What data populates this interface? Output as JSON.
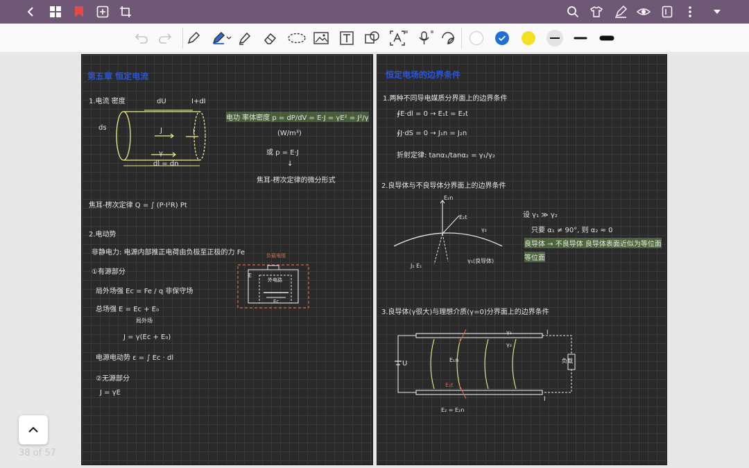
{
  "app": {
    "topbar_color": "#6f5876",
    "icons_left": [
      "back-icon",
      "grid-icon",
      "bookmark-icon",
      "add-page-icon",
      "crop-icon"
    ],
    "icons_right": [
      "search-icon",
      "shirt-icon",
      "pen-icon",
      "eye-icon",
      "book-icon",
      "more-icon",
      "chevron-down-icon"
    ]
  },
  "toolbar": {
    "tools": [
      "undo-icon",
      "redo-icon",
      "pen-tool-icon",
      "highlighter-icon",
      "marker-icon",
      "eraser-icon",
      "lasso-icon",
      "image-icon",
      "text-icon",
      "shapes-icon",
      "text-recognition-icon",
      "mic-icon",
      "sticker-icon"
    ],
    "colors": [
      "#ffffff",
      "#1e6fd9",
      "#f2e120"
    ],
    "stroke_widths": [
      "thin",
      "medium",
      "thick"
    ]
  },
  "left_page": {
    "title": "第五章 恒定电流",
    "lines": [
      "1.电流 密度",
      "dU",
      "I+dI",
      "ds",
      "J",
      "l",
      "γ",
      "dl = dn",
      "电功 率体密度  p = dP/dV = E·J = γE² = J²/γ",
      "(W/m³)",
      "或  p = E·J",
      "焦耳-楞次定律的微分形式",
      "焦耳-楞次定律  Q = ∫ (P·I²R) Pt",
      "2.电动势",
      "非静电力: 电源内部推正电荷由负极至正极的力  Fe",
      "①有源部分",
      "局外场强  Ec = Fe / q   非保守场",
      "总场强  E = Ec + E₀",
      "局外场",
      "J = γ(Ec + E₀)",
      "电源电动势  ε = ∫ Ec · dl",
      "②无源部分",
      "J = γE",
      "负载电阻",
      "外电路",
      "E",
      "Ec"
    ]
  },
  "right_page": {
    "title": "恒定电场的边界条件",
    "lines": [
      "1.两种不同导电媒质分界面上的边界条件",
      "∮E·dl = 0 → E₁t = E₂t",
      "∮J·dS = 0 → J₁n = J₂n",
      "折射定律:  tanα₁/tanα₂ = γ₁/γ₂",
      "2.良导体与不良导体分界面上的边界条件",
      "设  γ₁ ≫ γ₂",
      "只要 α₁ ≠ 90°, 则 α₂ ≈ 0",
      "良导体 → 不良导体  良导体表面近似为等位面",
      "等位面",
      "E₂n",
      "E₂t",
      "γ₂",
      "γ₁(良导体)",
      "J₁ E₁",
      "3.良导体(γ很大)与理想介质(γ=0)分界面上的边界条件",
      "U",
      "负载",
      "I",
      "I",
      "γ₁",
      "γ₂",
      "E₁n",
      "E₂t",
      "E₂ = E₂n"
    ]
  },
  "footer": {
    "page_count": "38 of 57"
  }
}
